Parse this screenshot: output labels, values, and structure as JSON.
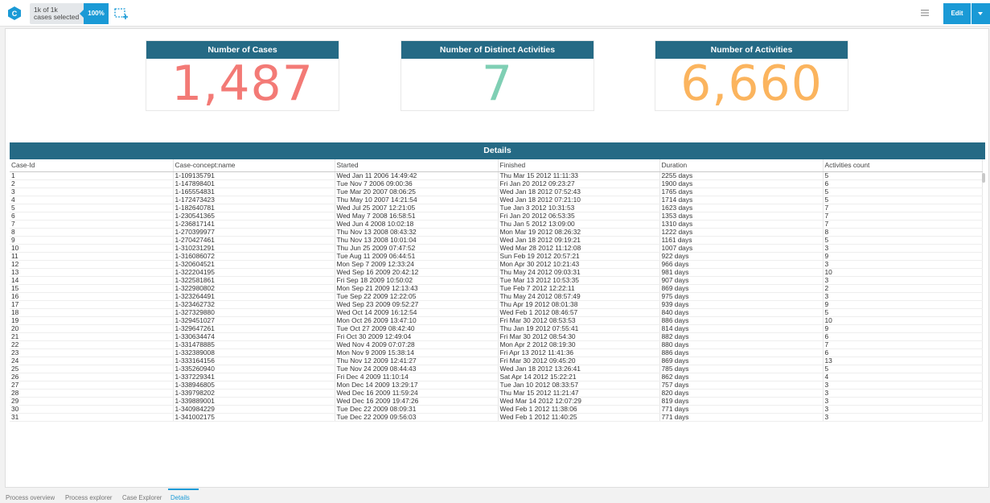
{
  "header": {
    "selection_line1": "1k of 1k",
    "selection_line2": "cases selected",
    "percent": "100%",
    "edit_label": "Edit",
    "accent": "#1a9ad6"
  },
  "kpis": [
    {
      "title": "Number of Cases",
      "value": "1,487",
      "color": "#f37a76"
    },
    {
      "title": "Number of Distinct Activities",
      "value": "7",
      "color": "#7fcfb4"
    },
    {
      "title": "Number of Activities",
      "value": "6,660",
      "color": "#fbb45e"
    }
  ],
  "details": {
    "title": "Details",
    "columns": [
      "Case-Id",
      "Case-concept:name",
      "Started",
      "Finished",
      "Duration",
      "Activities count"
    ],
    "rows": [
      [
        "1",
        "1-109135791",
        "Wed Jan 11 2006 14:49:42",
        "Thu Mar 15 2012 11:11:33",
        "2255 days",
        "5"
      ],
      [
        "2",
        "1-147898401",
        "Tue Nov 7 2006 09:00:36",
        "Fri Jan 20 2012 09:23:27",
        "1900 days",
        "6"
      ],
      [
        "3",
        "1-165554831",
        "Tue Mar 20 2007 08:06:25",
        "Wed Jan 18 2012 07:52:43",
        "1765 days",
        "5"
      ],
      [
        "4",
        "1-172473423",
        "Thu May 10 2007 14:21:54",
        "Wed Jan 18 2012 07:21:10",
        "1714 days",
        "5"
      ],
      [
        "5",
        "1-182640781",
        "Wed Jul 25 2007 12:21:05",
        "Tue Jan 3 2012 10:31:53",
        "1623 days",
        "7"
      ],
      [
        "6",
        "1-230541365",
        "Wed May 7 2008 16:58:51",
        "Fri Jan 20 2012 06:53:35",
        "1353 days",
        "7"
      ],
      [
        "7",
        "1-236817141",
        "Wed Jun 4 2008 10:02:18",
        "Thu Jan 5 2012 13:09:00",
        "1310 days",
        "7"
      ],
      [
        "8",
        "1-270399977",
        "Thu Nov 13 2008 08:43:32",
        "Mon Mar 19 2012 08:26:32",
        "1222 days",
        "8"
      ],
      [
        "9",
        "1-270427461",
        "Thu Nov 13 2008 10:01:04",
        "Wed Jan 18 2012 09:19:21",
        "1161 days",
        "5"
      ],
      [
        "10",
        "1-310231291",
        "Thu Jun 25 2009 07:47:52",
        "Wed Mar 28 2012 11:12:08",
        "1007 days",
        "3"
      ],
      [
        "11",
        "1-316086072",
        "Tue Aug 11 2009 06:44:51",
        "Sun Feb 19 2012 20:57:21",
        "922 days",
        "9"
      ],
      [
        "12",
        "1-320604521",
        "Mon Sep 7 2009 12:33:24",
        "Mon Apr 30 2012 10:21:43",
        "966 days",
        "3"
      ],
      [
        "13",
        "1-322204195",
        "Wed Sep 16 2009 20:42:12",
        "Thu May 24 2012 09:03:31",
        "981 days",
        "10"
      ],
      [
        "14",
        "1-322581861",
        "Fri Sep 18 2009 10:50:02",
        "Tue Mar 13 2012 10:53:35",
        "907 days",
        "3"
      ],
      [
        "15",
        "1-322980802",
        "Mon Sep 21 2009 12:13:43",
        "Tue Feb 7 2012 12:22:11",
        "869 days",
        "2"
      ],
      [
        "16",
        "1-323264491",
        "Tue Sep 22 2009 12:22:05",
        "Thu May 24 2012 08:57:49",
        "975 days",
        "3"
      ],
      [
        "17",
        "1-323462732",
        "Wed Sep 23 2009 09:52:27",
        "Thu Apr 19 2012 08:01:38",
        "939 days",
        "9"
      ],
      [
        "18",
        "1-327329880",
        "Wed Oct 14 2009 16:12:54",
        "Wed Feb 1 2012 08:46:57",
        "840 days",
        "5"
      ],
      [
        "19",
        "1-329451027",
        "Mon Oct 26 2009 13:47:10",
        "Fri Mar 30 2012 08:53:53",
        "886 days",
        "10"
      ],
      [
        "20",
        "1-329647261",
        "Tue Oct 27 2009 08:42:40",
        "Thu Jan 19 2012 07:55:41",
        "814 days",
        "9"
      ],
      [
        "21",
        "1-330634474",
        "Fri Oct 30 2009 12:49:04",
        "Fri Mar 30 2012 08:54:30",
        "882 days",
        "6"
      ],
      [
        "22",
        "1-331478885",
        "Wed Nov 4 2009 07:07:28",
        "Mon Apr 2 2012 08:19:30",
        "880 days",
        "7"
      ],
      [
        "23",
        "1-332389008",
        "Mon Nov 9 2009 15:38:14",
        "Fri Apr 13 2012 11:41:36",
        "886 days",
        "6"
      ],
      [
        "24",
        "1-333164156",
        "Thu Nov 12 2009 12:41:27",
        "Fri Mar 30 2012 09:45:20",
        "869 days",
        "13"
      ],
      [
        "25",
        "1-335260940",
        "Tue Nov 24 2009 08:44:43",
        "Wed Jan 18 2012 13:26:41",
        "785 days",
        "5"
      ],
      [
        "26",
        "1-337229341",
        "Fri Dec 4 2009 11:10:14",
        "Sat Apr 14 2012 15:22:21",
        "862 days",
        "4"
      ],
      [
        "27",
        "1-338946805",
        "Mon Dec 14 2009 13:29:17",
        "Tue Jan 10 2012 08:33:57",
        "757 days",
        "3"
      ],
      [
        "28",
        "1-339798202",
        "Wed Dec 16 2009 11:59:24",
        "Thu Mar 15 2012 11:21:47",
        "820 days",
        "3"
      ],
      [
        "29",
        "1-339889001",
        "Wed Dec 16 2009 19:47:26",
        "Wed Mar 14 2012 12:07:29",
        "819 days",
        "3"
      ],
      [
        "30",
        "1-340984229",
        "Tue Dec 22 2009 08:09:31",
        "Wed Feb 1 2012 11:38:06",
        "771 days",
        "3"
      ],
      [
        "31",
        "1-341002175",
        "Tue Dec 22 2009 09:56:03",
        "Wed Feb 1 2012 11:40:25",
        "771 days",
        "3"
      ]
    ]
  },
  "tabs": [
    {
      "label": "Process overview",
      "active": false
    },
    {
      "label": "Process explorer",
      "active": false
    },
    {
      "label": "Case Explorer",
      "active": false
    },
    {
      "label": "Details",
      "active": true
    }
  ]
}
